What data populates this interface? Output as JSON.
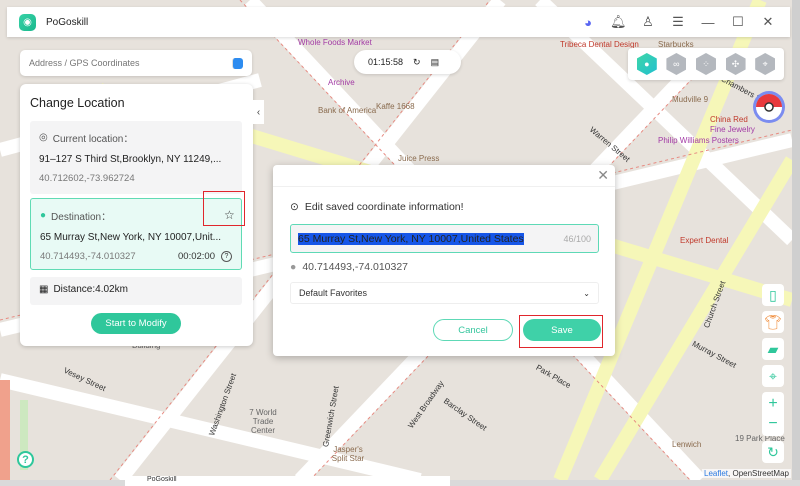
{
  "app": {
    "title": "PoGoskill"
  },
  "titlebar": {
    "icons": [
      "discord-icon",
      "bell-icon",
      "user-icon",
      "menu-icon",
      "minimize-icon",
      "maximize-icon",
      "close-icon"
    ]
  },
  "search": {
    "placeholder": "Address / GPS Coordinates"
  },
  "timer": {
    "value": "01:15:58"
  },
  "modes": [
    "teleport-mode",
    "two-spot-mode",
    "multi-spot-mode",
    "joystick-mode",
    "jump-teleport-mode"
  ],
  "panel": {
    "title": "Change Location",
    "current_label": "Current location：",
    "current_address": "91–127 S Third St,Brooklyn, NY  11249,...",
    "current_coords": "40.712602,-73.962724",
    "destination_label": "Destination：",
    "destination_address": "65 Murray St,New York, NY  10007,Unit...",
    "destination_coords": "40.714493,-74.010327",
    "destination_time": "00:02:00",
    "distance": "Distance:4.02km",
    "start_button": "Start to Modify"
  },
  "dialog": {
    "message": "Edit saved coordinate information!",
    "name_value": "65 Murray St,New York, NY  10007,United States",
    "char_count": "46/100",
    "coords": "40.714493,-74.010327",
    "folder": "Default Favorites",
    "cancel": "Cancel",
    "save": "Save"
  },
  "map": {
    "labels": [
      "Whole Foods Market",
      "Archive",
      "Bank of America",
      "Kaffe 1668",
      "Juice Press",
      "Tribeca Dental Design",
      "Starbucks",
      "Mudville 9",
      "China Red",
      "Fine Jewelry",
      "Chambers Street",
      "Warren Street",
      "Philip Williams Posters",
      "Expert Dental",
      "Church Street",
      "Murray Street",
      "Park Place",
      "Barclay Street",
      "West Broadway",
      "Greenwich Street",
      "Washington Street",
      "Vesey Street",
      "7 World Trade Center",
      "Jasper's Split Star",
      "19 Park Place",
      "Lenwich",
      "Building"
    ],
    "attribution_leaflet": "Leaflet",
    "attribution_osm": "OpenStreetMap"
  },
  "taskbar": {
    "window_title": "PoGoskill"
  }
}
